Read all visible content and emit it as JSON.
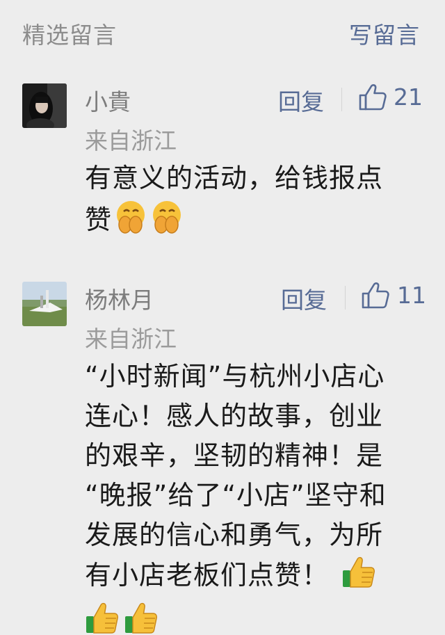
{
  "header": {
    "title": "精选留言",
    "write_label": "写留言"
  },
  "comments": [
    {
      "name": "小貴",
      "reply_label": "回复",
      "like_count": "21",
      "location": "来自浙江",
      "text_lines": [
        "有意义的活动，给钱报点",
        "赞"
      ],
      "emojis": [
        "hands-over-mouth-emoji",
        "hands-over-mouth-emoji"
      ]
    },
    {
      "name": "杨林月",
      "reply_label": "回复",
      "like_count": "11",
      "location": "来自浙江",
      "text_lines": [
        "“小时新闻”与杭州小店心",
        "连心！感人的故事，创业",
        "的艰辛，坚韧的精神！是",
        "“晚报”给了“小店”坚守和",
        "发展的信心和勇气，为所",
        "有小店老板们点赞！"
      ],
      "emojis": [
        "thumbs-up-emoji",
        "thumbs-up-emoji",
        "thumbs-up-emoji"
      ]
    }
  ],
  "colors": {
    "background": "#ededed",
    "link": "#576b95",
    "muted": "#8c8c8c",
    "text": "#1a1a1a"
  }
}
